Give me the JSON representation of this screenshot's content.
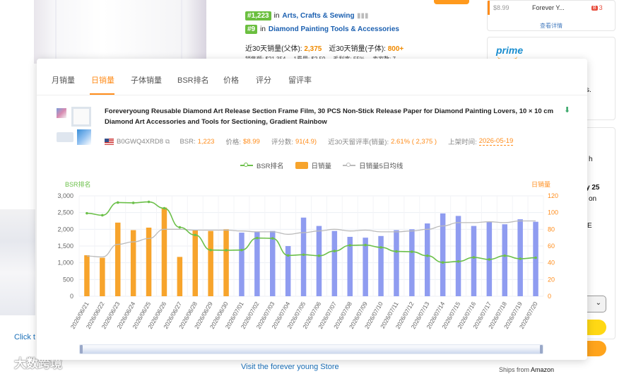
{
  "background": {
    "rank1": {
      "badge": "#1,223",
      "in": "in",
      "category": "Arts, Crafts & Sewing"
    },
    "rank2": {
      "badge": "#9",
      "in": "in",
      "category": "Diamond Painting Tools & Accessories"
    },
    "stats": {
      "parent_label": "近30天销量(父体):",
      "parent_value": "2,375",
      "child_label": "近30天销量(子体):",
      "child_value": "800+"
    },
    "stats_row2": "销售额: $21,354 ... 1费用: $2.59 ... 毛利率: 55% ... 卖家数: 7",
    "click_text": "Click t",
    "visit_store": "Visit the forever young Store",
    "ships_label": "Ships from",
    "ships_value": "Amazon",
    "right_price": "$8.99",
    "right_name": "Forever Y...",
    "right_badge": "B",
    "right_count": "3",
    "right_detail": "查看详情",
    "prime": "prime",
    "right_frag1": "s.",
    "right_frag2": "h",
    "right_frag3": "y 25",
    "right_frag4": "on",
    "right_frag5": "E",
    "select_chevron": "⌄",
    "logo_text": "大数跨境"
  },
  "tabs": [
    {
      "label": "月销量",
      "active": false
    },
    {
      "label": "日销量",
      "active": true
    },
    {
      "label": "子体销量",
      "active": false
    },
    {
      "label": "BSR排名",
      "active": false
    },
    {
      "label": "价格",
      "active": false
    },
    {
      "label": "评分",
      "active": false
    },
    {
      "label": "留评率",
      "active": false
    }
  ],
  "product": {
    "title": "Foreveryoung Reusable Diamond Art Release Section Frame Film, 30 PCS Non-Stick Release Paper for Diamond Painting Lovers, 10 × 10 cm Diamond Art Accessories and Tools for Sectioning, Gradient Rainbow",
    "asin": "B0GWQ4XRD8",
    "bsr_label": "BSR:",
    "bsr_value": "1,223",
    "price_label": "价格:",
    "price_value": "$8.99",
    "reviews_label": "评分数:",
    "reviews_value": "91(4.9)",
    "review_rate_label": "近30天留评率(销量):",
    "review_rate_value": "2.61% ( 2,375 )",
    "listed_label": "上架时间:",
    "listed_value": "2026-05-19"
  },
  "legend": {
    "bsr": "BSR排名",
    "daily": "日销量",
    "avg": "日销量5日均线"
  },
  "colors": {
    "accent": "#ff8c1a",
    "bsr_line": "#6cc04a",
    "bar_orange": "#f7a42c",
    "bar_blue": "#8f9cf0",
    "avg_line": "#bbbbbb"
  },
  "chart_data": {
    "type": "bar",
    "left_axis_label": "BSR排名",
    "right_axis_label": "日销量",
    "left_ylim": [
      0,
      3000
    ],
    "left_ticks": [
      "0",
      "500",
      "1,000",
      "1,500",
      "2,000",
      "2,500",
      "3,000"
    ],
    "right_ylim": [
      0,
      120
    ],
    "right_ticks": [
      "0",
      "20",
      "40",
      "60",
      "80",
      "100",
      "120"
    ],
    "categories": [
      "2026/06/21",
      "2026/06/22",
      "2026/06/23",
      "2026/06/24",
      "2026/06/25",
      "2026/06/26",
      "2026/06/27",
      "2026/06/28",
      "2026/06/29",
      "2026/06/30",
      "2026/07/01",
      "2026/07/02",
      "2026/07/03",
      "2026/07/04",
      "2026/07/05",
      "2026/07/06",
      "2026/07/07",
      "2026/07/08",
      "2026/07/09",
      "2026/07/10",
      "2026/07/11",
      "2026/07/12",
      "2026/07/13",
      "2026/07/14",
      "2026/07/15",
      "2026/07/16",
      "2026/07/17",
      "2026/07/18",
      "2026/07/19",
      "2026/07/20"
    ],
    "series": [
      {
        "name": "日销量",
        "axis": "right",
        "type": "bar",
        "values": [
          49,
          46,
          88,
          79,
          82,
          106,
          47,
          79,
          78,
          80,
          76,
          77,
          78,
          60,
          94,
          84,
          78,
          71,
          70,
          72,
          79,
          80,
          87,
          99,
          96,
          84,
          89,
          86,
          92,
          89
        ],
        "bar_colors": [
          "orange",
          "orange",
          "orange",
          "orange",
          "orange",
          "orange",
          "orange",
          "orange",
          "orange",
          "orange",
          "blue",
          "blue",
          "blue",
          "blue",
          "blue",
          "blue",
          "blue",
          "blue",
          "blue",
          "blue",
          "blue",
          "blue",
          "blue",
          "blue",
          "blue",
          "blue",
          "blue",
          "blue",
          "blue",
          "blue"
        ]
      },
      {
        "name": "BSR排名",
        "axis": "left",
        "type": "line",
        "values": [
          2480,
          2420,
          2800,
          2790,
          2820,
          2630,
          2060,
          1830,
          1380,
          1375,
          1380,
          1740,
          1730,
          1220,
          1240,
          1210,
          1350,
          1520,
          1530,
          1460,
          1340,
          1330,
          1210,
          1010,
          1040,
          1160,
          1100,
          1210,
          1120,
          1150
        ]
      },
      {
        "name": "日销量5日均线",
        "axis": "right",
        "type": "line",
        "values": [
          48,
          47,
          62,
          65,
          69,
          80,
          80,
          79,
          79,
          79,
          78,
          77,
          77,
          74,
          76,
          78,
          80,
          78,
          79,
          77,
          77,
          78,
          80,
          84,
          88,
          88,
          89,
          88,
          90,
          90
        ]
      }
    ]
  }
}
